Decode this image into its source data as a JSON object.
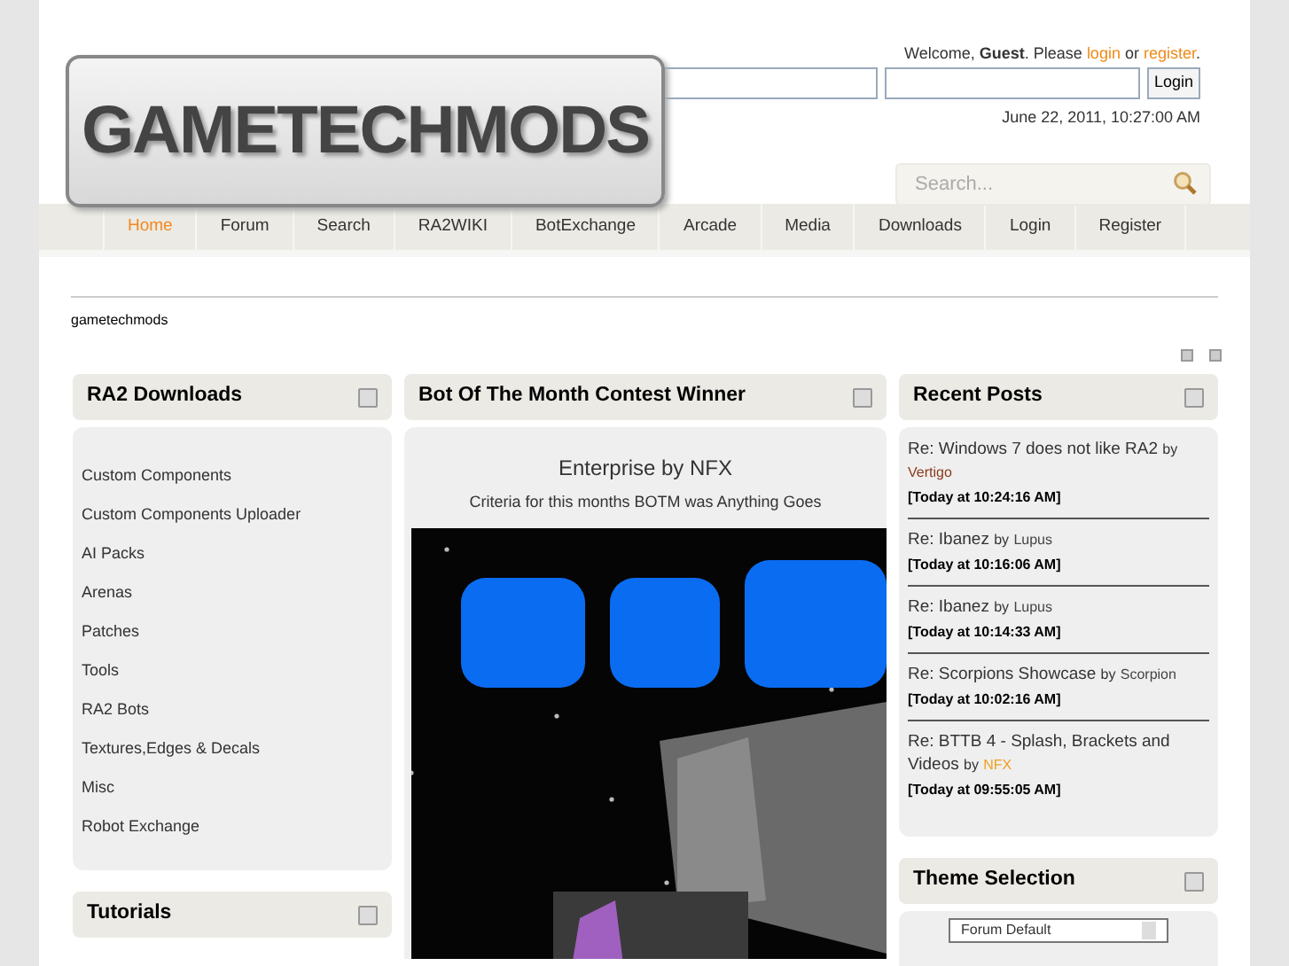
{
  "header": {
    "logo_text": "GAMETECHMODS",
    "welcome": {
      "text": "Welcome, **Guest**. Please",
      "login_link": "login",
      "joiner": "or",
      "register_link": "register",
      "end": "."
    },
    "login_button": "Login",
    "date": "June 22, 2011, 10:27:00 AM",
    "search": {
      "placeholder": "Search..."
    }
  },
  "nav": [
    {
      "label": "Home",
      "selected": true
    },
    {
      "label": "Forum",
      "selected": false
    },
    {
      "label": "Search",
      "selected": false
    },
    {
      "label": "RA2WIKI",
      "selected": false
    },
    {
      "label": "BotExchange",
      "selected": false
    },
    {
      "label": "Arcade",
      "selected": false
    },
    {
      "label": "Media",
      "selected": false
    },
    {
      "label": "Downloads",
      "selected": false
    },
    {
      "label": "Login",
      "selected": false
    },
    {
      "label": "Register",
      "selected": false
    }
  ],
  "breadcrumb": "gametechmods",
  "left_column": [
    {
      "title": "RA2 Downloads",
      "links": [
        "Custom Components",
        "Custom Components Uploader",
        "AI Packs",
        "Arenas",
        "Patches",
        "Tools",
        "RA2 Bots",
        "Textures,Edges & Decals",
        "Misc",
        "Robot Exchange"
      ]
    },
    {
      "title": "Tutorials"
    }
  ],
  "botm": {
    "title": "Bot Of The Month Contest Winner",
    "heading": "Enterprise by NFX",
    "criteria": "Criteria for this months BOTM was Anything Goes"
  },
  "recent_posts": {
    "title": "Recent Posts",
    "posts": [
      {
        "subject": "Re: Windows 7 does not like RA2",
        "by": "by",
        "author": "Vertigo",
        "color": "#8b3a1a",
        "time": "[**Today** at 10:24:16 AM]"
      },
      {
        "subject": "Re: Ibanez",
        "by": "by",
        "author": "Lupus",
        "color": "#444444",
        "time": "[**Today** at 10:16:06 AM]"
      },
      {
        "subject": "Re: Ibanez",
        "by": "by",
        "author": "Lupus",
        "color": "#444444",
        "time": "[**Today** at 10:14:33 AM]"
      },
      {
        "subject": "Re: Scorpions Showcase",
        "by": "by",
        "author": "Scorpion",
        "color": "#444444",
        "time": "[**Today** at 10:02:16 AM]"
      },
      {
        "subject": "Re: BTTB 4 - Splash, Brackets and Videos",
        "by": "by",
        "author": "NFX",
        "color": "#f0a020",
        "time": "[**Today** at 09:55:05 AM]"
      }
    ]
  },
  "theme_selection": {
    "title": "Theme Selection",
    "value": "Forum Default"
  }
}
